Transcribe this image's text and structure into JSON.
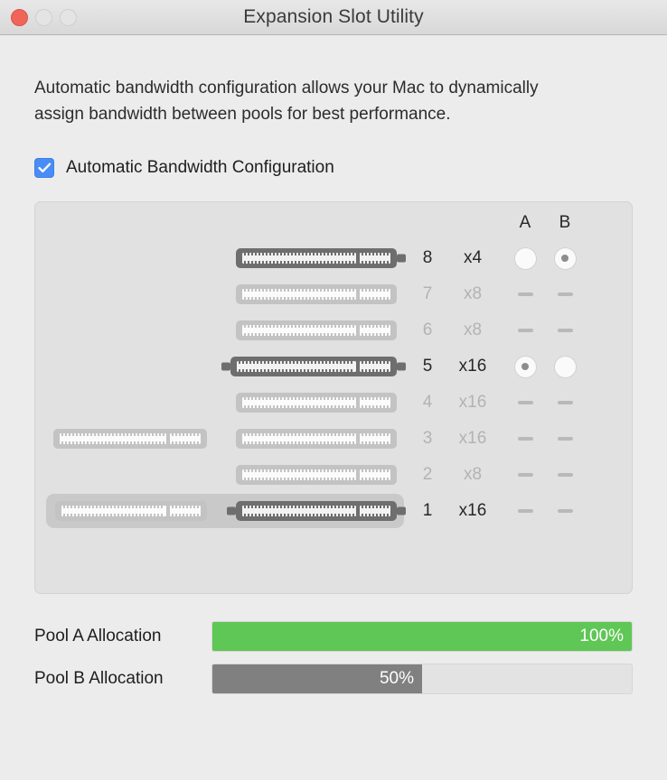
{
  "window": {
    "title": "Expansion Slot Utility",
    "traffic_lights": [
      {
        "name": "close",
        "color": "#f0655a"
      },
      {
        "name": "minimize",
        "color": "#e4e4e4"
      },
      {
        "name": "maximize",
        "color": "#e4e4e4"
      }
    ]
  },
  "description": "Automatic bandwidth configuration allows your Mac to dynamically assign bandwidth between pools for best performance.",
  "auto_config": {
    "label": "Automatic Bandwidth Configuration",
    "checked": true,
    "accent_color": "#4a8cf7",
    "icon": "checkmark-icon"
  },
  "slot_table": {
    "column_headers": {
      "a": "A",
      "b": "B"
    },
    "rows": [
      {
        "slot": "8",
        "lane": "x4",
        "enabled": true,
        "a": "unselected",
        "b": "selected",
        "card": "single-right-occupied"
      },
      {
        "slot": "7",
        "lane": "x8",
        "enabled": false,
        "a": "dash",
        "b": "dash",
        "card": "single-right-empty"
      },
      {
        "slot": "6",
        "lane": "x8",
        "enabled": false,
        "a": "dash",
        "b": "dash",
        "card": "single-right-empty"
      },
      {
        "slot": "5",
        "lane": "x16",
        "enabled": true,
        "a": "selected",
        "b": "unselected",
        "card": "single-right-occupied-wide"
      },
      {
        "slot": "4",
        "lane": "x16",
        "enabled": false,
        "a": "dash",
        "b": "dash",
        "card": "single-right-empty"
      },
      {
        "slot": "3",
        "lane": "x16",
        "enabled": false,
        "a": "dash",
        "b": "dash",
        "card": "double-empty"
      },
      {
        "slot": "2",
        "lane": "x8",
        "enabled": false,
        "a": "dash",
        "b": "dash",
        "card": "single-right-empty"
      },
      {
        "slot": "1",
        "lane": "x16",
        "enabled": true,
        "a": "dash",
        "b": "dash",
        "card": "double-highlighted"
      }
    ]
  },
  "allocations": [
    {
      "label": "Pool A Allocation",
      "value": "100%",
      "percent": 100,
      "color": "#5fc755"
    },
    {
      "label": "Pool B Allocation",
      "value": "50%",
      "percent": 50,
      "color": "#808080"
    }
  ]
}
